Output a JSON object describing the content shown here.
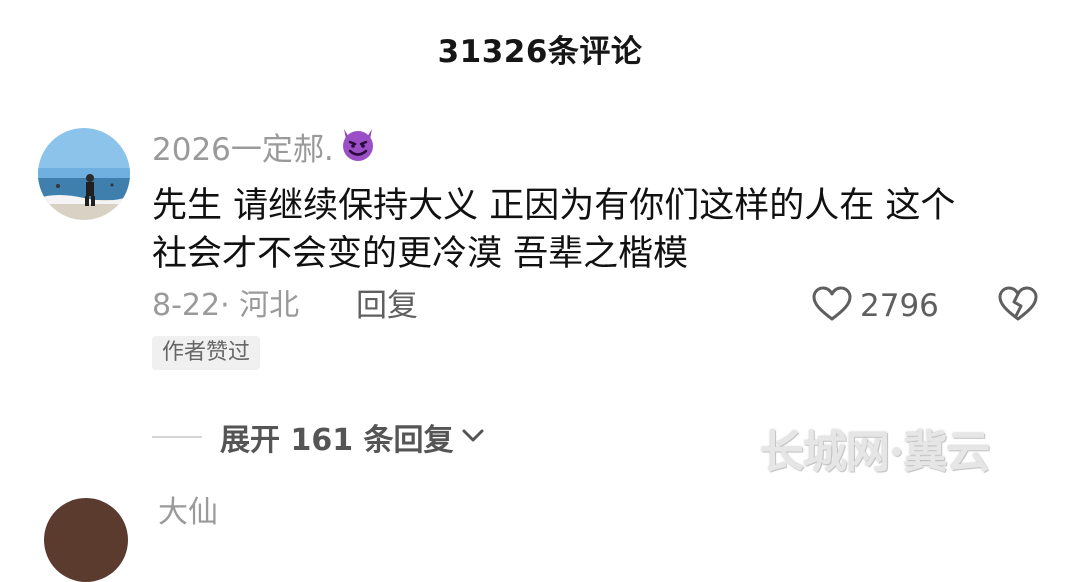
{
  "header": {
    "title": "31326条评论"
  },
  "comment": {
    "username": "2026一定郝.",
    "emoji_icon": "smiling-devil-icon",
    "text_line1": "先生 请继续保持大义 正因为有你们这样的人在 这个",
    "text_line2": "社会才不会变的更冷漠 吾辈之楷模",
    "date_location": "8-22· 河北",
    "reply_label": "回复",
    "like_count": "2796",
    "author_badge": "作者赞过",
    "expand_label": "展开 161 条回复"
  },
  "watermark": "长城网·冀云",
  "next_comment": {
    "username": "大仙"
  },
  "colors": {
    "accent_gray": "#9a9a9a",
    "text": "#111111",
    "badge_bg": "#f0f0f0"
  }
}
